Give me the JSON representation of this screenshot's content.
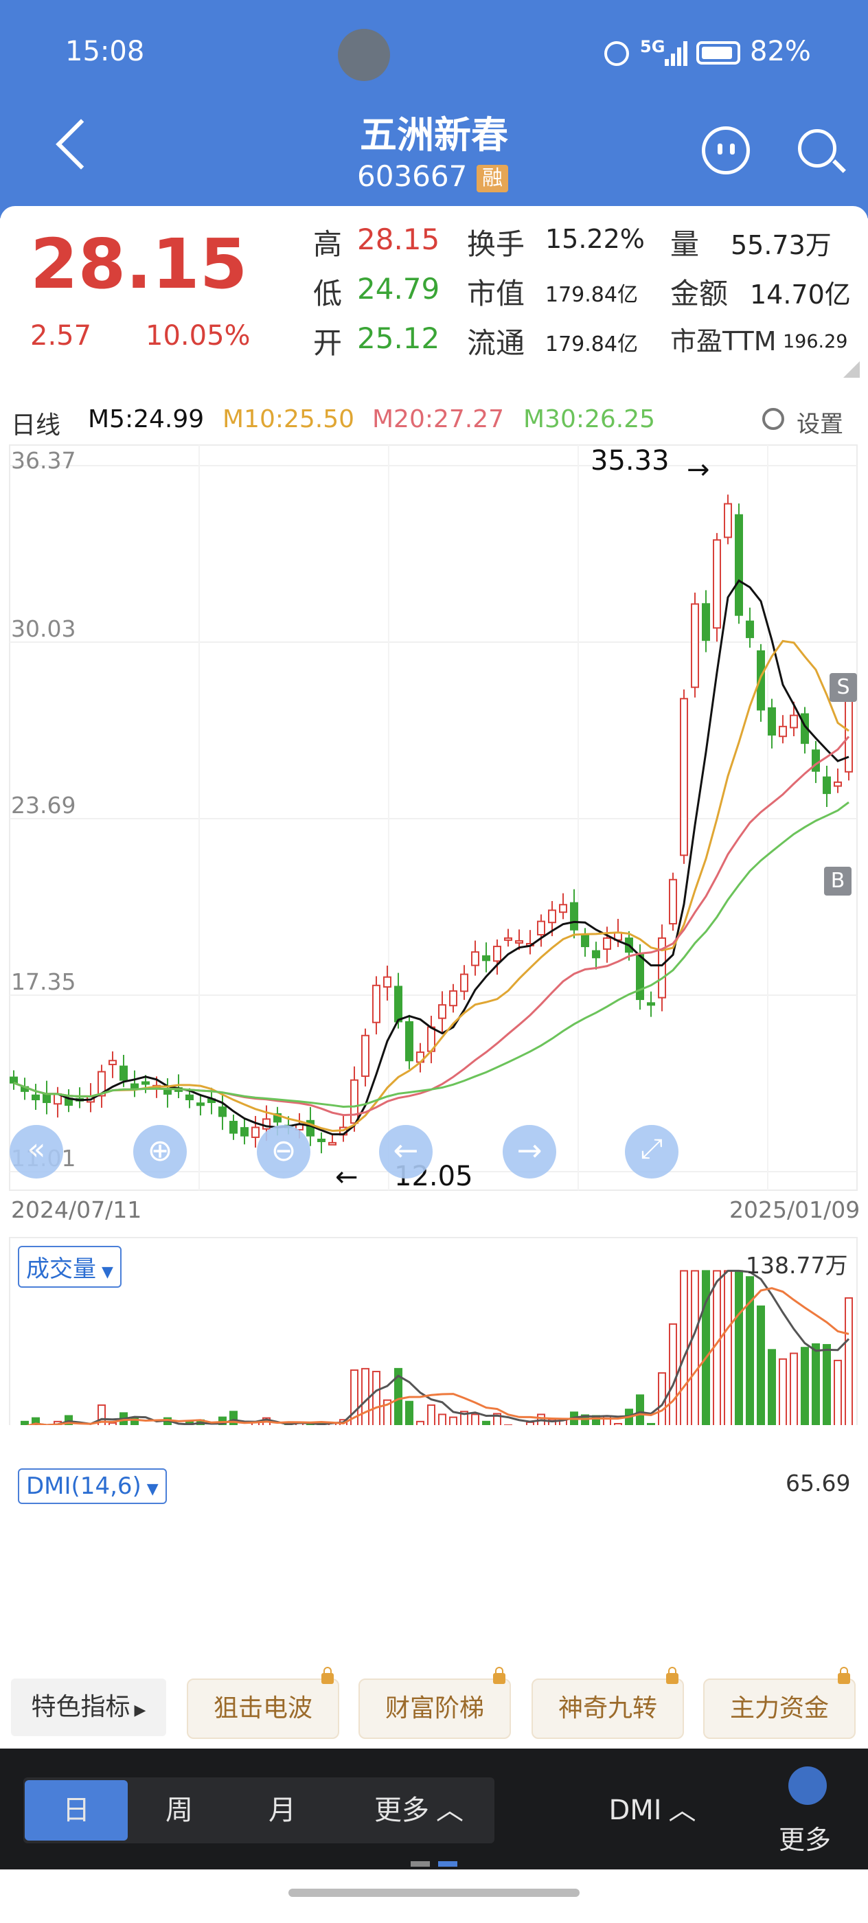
{
  "status_bar": {
    "time": "15:08",
    "signal": "5G",
    "battery": "82%"
  },
  "header": {
    "name": "五洲新春",
    "code": "603667",
    "badge": "融"
  },
  "quote": {
    "price": "28.15",
    "change": "2.57",
    "change_pct": "10.05%",
    "high_label": "高",
    "high": "28.15",
    "low_label": "低",
    "low": "24.79",
    "open_label": "开",
    "open": "25.12",
    "turnover_label": "换手",
    "turnover": "15.22%",
    "mktcap_label": "市值",
    "mktcap": "179.84亿",
    "float_label": "流通",
    "float": "179.84亿",
    "vol_label": "量",
    "vol": "55.73万",
    "amount_label": "金额",
    "amount": "14.70亿",
    "pe_label": "市盈TTM",
    "pe": "196.29"
  },
  "ma_bar": {
    "period": "日线",
    "m5": "M5:24.99",
    "m10": "M10:25.50",
    "m20": "M20:27.27",
    "m30": "M30:26.25",
    "settings": "设置"
  },
  "chart_data": {
    "type": "candlestick",
    "title": "",
    "x_start": "2024/07/11",
    "x_end": "2025/01/09",
    "y_ticks": [
      "36.37",
      "30.03",
      "23.69",
      "17.35",
      "11.01"
    ],
    "ylim": [
      11.01,
      36.37
    ],
    "annotations": [
      {
        "text": "35.33",
        "kind": "high"
      },
      {
        "text": "12.05",
        "kind": "low"
      }
    ],
    "signals": [
      "S",
      "B"
    ],
    "closes": [
      14.2,
      13.9,
      13.6,
      13.5,
      13.8,
      13.4,
      13.6,
      13.7,
      14.6,
      15.0,
      14.3,
      14.0,
      14.2,
      14.1,
      13.8,
      13.9,
      13.6,
      13.4,
      13.5,
      13.0,
      12.4,
      12.3,
      12.6,
      12.9,
      12.8,
      12.6,
      12.7,
      12.3,
      12.1,
      12.05,
      12.6,
      14.3,
      15.9,
      17.7,
      18.0,
      16.4,
      15.0,
      15.3,
      16.2,
      17.0,
      17.5,
      18.1,
      18.9,
      18.6,
      19.1,
      19.4,
      19.3,
      19.2,
      20.0,
      20.4,
      20.6,
      19.7,
      19.1,
      18.7,
      19.4,
      19.6,
      18.9,
      17.2,
      17.0,
      19.4,
      21.5,
      28.0,
      31.4,
      30.1,
      33.7,
      35.0,
      31.0,
      30.2,
      27.6,
      26.7,
      27.0,
      27.4,
      26.4,
      25.4,
      24.6,
      25.0,
      28.15
    ],
    "indicators": {
      "volume": {
        "label": "成交量",
        "max_label": "138.77万"
      },
      "dmi": {
        "label": "DMI(14,6)",
        "value_label": "65.69"
      }
    }
  },
  "features": {
    "label": "特色指标",
    "items": [
      "狙击电波",
      "财富阶梯",
      "神奇九转",
      "主力资金"
    ]
  },
  "bottom_bar": {
    "periods": [
      "日",
      "周",
      "月"
    ],
    "more": "更多",
    "indicator": "DMI",
    "more_right": "更多"
  },
  "colors": {
    "header": "#4a7fd8",
    "up": "#d8403a",
    "down": "#3aa536",
    "m5": "#111111",
    "m10": "#e0a633",
    "m20": "#e06a72",
    "m30": "#6bc35a"
  }
}
